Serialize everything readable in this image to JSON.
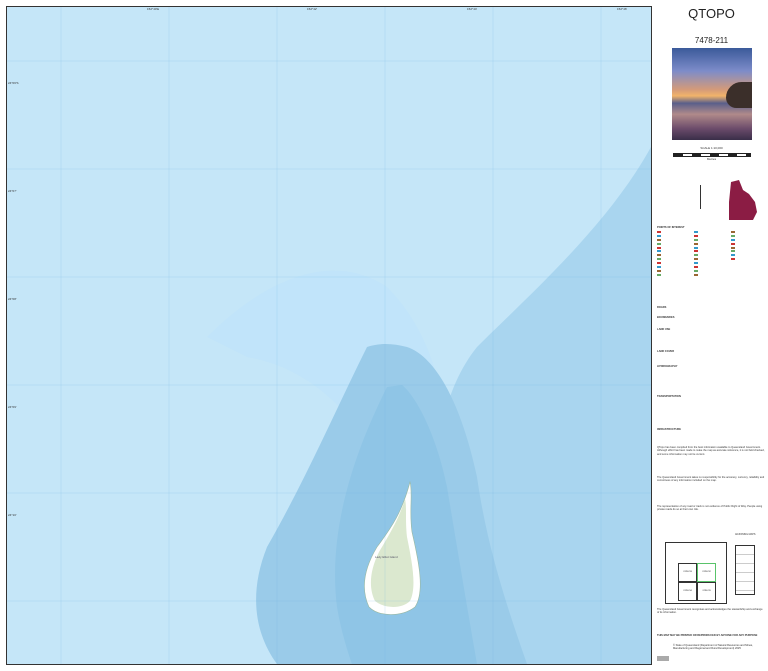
{
  "map": {
    "island_label": "Lady Elliot Island",
    "colors": {
      "shallow": "#c5e6f8",
      "mid": "#a9d5ef",
      "deep": "#8fc5e6",
      "reef": "#bde4fb",
      "land": "#e4ecd9",
      "sand": "#ffffff"
    },
    "top_ticks": [
      "152°40'E",
      "152°42'",
      "152°44'",
      "152°46'"
    ],
    "left_ticks": [
      "24°06'S",
      "24°07'",
      "24°08'",
      "24°09'",
      "24°10'"
    ]
  },
  "panel": {
    "title": "QTOPO",
    "sheet_number": "7478-211",
    "scale": "SCALE 1:10,000",
    "scale_unit": "Metres",
    "legend_heading": "POINTS OF INTEREST",
    "legend_sections": [
      "ROADS",
      "BOUNDARIES",
      "LAND USE",
      "LAND COVER",
      "HYDROGRAPHY",
      "TRANSPORTATION",
      "INFRASTRUCTURE"
    ],
    "disclaimer_1": "QTopo has been compiled from the best information available to Queensland Government. Although effort has been made to make the map as accurate reference, it is not field checked, and some information may not be current.",
    "disclaimer_2": "The Queensland Government takes no responsibility for the accuracy, currency, reliability and correctness of any information included on the map.",
    "disclaimer_3": "The representation of any road or track is not evidence of Public Right of Way. People using private roads do so at their own risk.",
    "acknowledgement": "The Queensland Government recognises and acknowledges the stewardship and exchange of its information.",
    "footer_note": "THIS MAP MAY BE PRINTED OR REPRODUCED BY ANYONE FOR ANY PURPOSE",
    "copyright": "© State of Queensland (Department of Natural Resources and Mines, Manufacturing and Regional and Rural Development) 2025",
    "adjoining_label": "ADJOINING MAPS",
    "adjoining_sheets": [
      "7478-213",
      "7478-212",
      "7478-214",
      "7478-211"
    ]
  }
}
